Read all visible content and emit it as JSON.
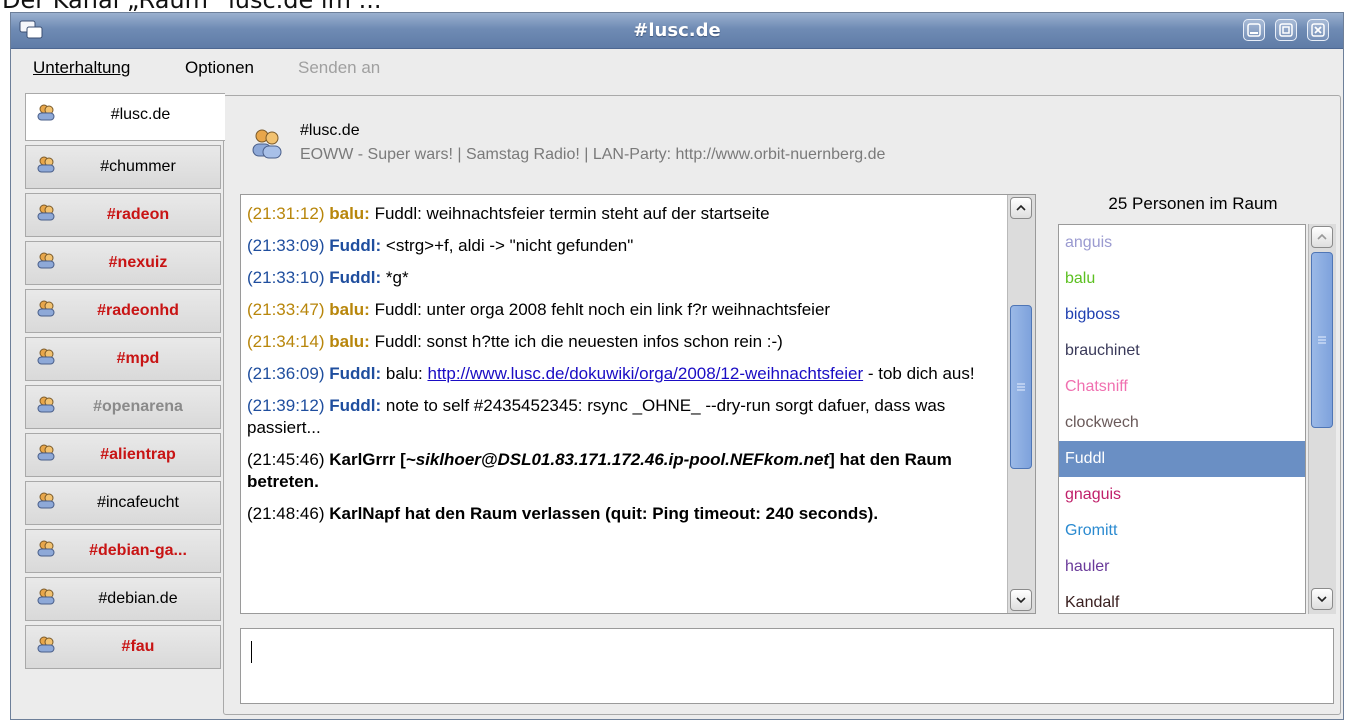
{
  "caption": "Der Kanal „Raum“ lusc.de im ...",
  "window": {
    "title": "#lusc.de"
  },
  "menu": {
    "items": [
      "Unterhaltung",
      "Optionen"
    ],
    "disabled": "Senden an"
  },
  "tabs": [
    {
      "label": "#lusc.de",
      "style": "active"
    },
    {
      "label": "#chummer",
      "style": "normal"
    },
    {
      "label": "#radeon",
      "style": "red"
    },
    {
      "label": "#nexuiz",
      "style": "red"
    },
    {
      "label": "#radeonhd",
      "style": "red"
    },
    {
      "label": "#mpd",
      "style": "red"
    },
    {
      "label": "#openarena",
      "style": "grey"
    },
    {
      "label": "#alientrap",
      "style": "red"
    },
    {
      "label": "#incafeucht",
      "style": "normal"
    },
    {
      "label": "#debian-ga...",
      "style": "red"
    },
    {
      "label": "#debian.de",
      "style": "normal"
    },
    {
      "label": "#fau",
      "style": "red"
    }
  ],
  "room": {
    "name": "#lusc.de",
    "topic": "EOWW - Super wars! | Samstag Radio! | LAN-Party: http://www.orbit-nuernberg.de"
  },
  "chat": [
    {
      "ts": "(21:31:12)",
      "nick": "balu:",
      "who": "balu",
      "text": "Fuddl: weihnachtsfeier termin steht auf der startseite"
    },
    {
      "ts": "(21:33:09)",
      "nick": "Fuddl:",
      "who": "fuddl",
      "text": "<strg>+f, aldi -> \"nicht gefunden\""
    },
    {
      "ts": "(21:33:10)",
      "nick": "Fuddl:",
      "who": "fuddl",
      "text": "*g*"
    },
    {
      "ts": "(21:33:47)",
      "nick": "balu:",
      "who": "balu",
      "text": "Fuddl: unter orga 2008 fehlt noch ein link f?r weihnachtsfeier"
    },
    {
      "ts": "(21:34:14)",
      "nick": "balu:",
      "who": "balu",
      "text": "Fuddl: sonst h?tte ich die neuesten infos schon rein :-)"
    },
    {
      "ts": "(21:36:09)",
      "nick": "Fuddl:",
      "who": "fuddl",
      "pre": "balu: ",
      "link": "http://www.lusc.de/dokuwiki/orga/2008/12-weihnachtsfeier",
      "text": " - tob dich aus!"
    },
    {
      "ts": "(21:39:12)",
      "nick": "Fuddl:",
      "who": "fuddl",
      "text": "note to self #2435452345: rsync _OHNE_ --dry-run sorgt dafuer, dass was passiert..."
    },
    {
      "ts": "(21:45:46)",
      "sys_nick": "KarlGrrr [",
      "sys_host": "~siklhoer@DSL01.83.171.172.46.ip-pool.NEFkom.net",
      "sys_rest": "] hat den Raum betreten."
    },
    {
      "ts": "(21:48:46)",
      "sys_nick": "KarlNapf hat den Raum verlassen (quit: Ping timeout: 240 seconds).",
      "sys_host": "",
      "sys_rest": ""
    }
  ],
  "users": {
    "count_label": "25 Personen im Raum",
    "list": [
      {
        "name": "anguis",
        "color": "#9a9ad0"
      },
      {
        "name": "balu",
        "color": "#5cc021"
      },
      {
        "name": "bigboss",
        "color": "#1f3fb0"
      },
      {
        "name": "brauchinet",
        "color": "#3a3a5a"
      },
      {
        "name": "Chatsniff",
        "color": "#f070b0"
      },
      {
        "name": "clockwech",
        "color": "#6a5a5a"
      },
      {
        "name": "Fuddl",
        "color": "#ffffff",
        "selected": true
      },
      {
        "name": "gnaguis",
        "color": "#c0206a"
      },
      {
        "name": "Gromitt",
        "color": "#2a8ad0"
      },
      {
        "name": "hauler",
        "color": "#6a3a9a"
      },
      {
        "name": "Kandalf",
        "color": "#3a2020"
      }
    ]
  }
}
